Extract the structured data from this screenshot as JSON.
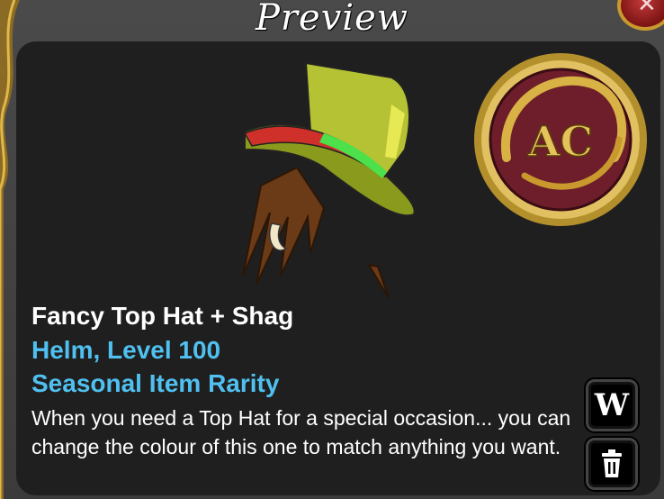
{
  "window": {
    "title": "Preview",
    "close_icon": "close-x-icon"
  },
  "item": {
    "name": "Fancy Top Hat + Shag",
    "type_level": "Helm, Level 100",
    "rarity": "Seasonal Item Rarity",
    "description": "When you need a Top Hat for a special occasion... you can change the colour of this one to match anything you want.",
    "currency_badge_text": "AC"
  },
  "buttons": {
    "wear_label": "W",
    "delete_icon": "trash-icon"
  },
  "colors": {
    "highlight_blue": "#4fc0ef",
    "panel_bg": "#1f1f1f",
    "gold": "#c9992e",
    "badge_red": "#6e1e2a",
    "hat_green": "#a4b52a"
  }
}
